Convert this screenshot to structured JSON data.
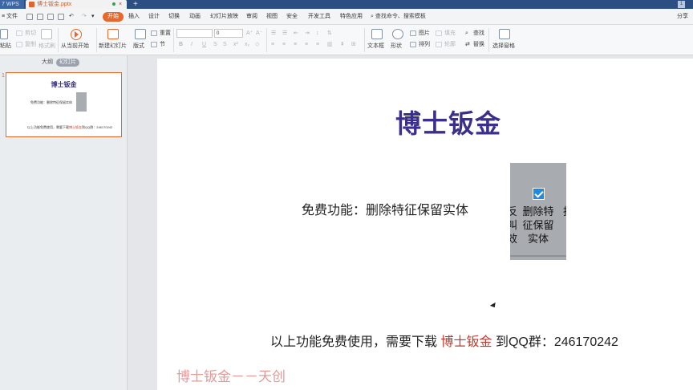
{
  "titlebar": {
    "app_tab": "7 WPS",
    "doc_tab": "博士钣金.pptx",
    "close_glyph": "×",
    "new_tab_glyph": "+",
    "window_badge": "1"
  },
  "menubar": {
    "file_label": "文件",
    "tabs": [
      "开始",
      "插入",
      "设计",
      "切换",
      "动画",
      "幻灯片放映",
      "审阅",
      "视图",
      "安全",
      "开发工具",
      "特色应用"
    ],
    "active_tab": "开始",
    "search_label": "查找命令、搜索模板",
    "share_label": "分享"
  },
  "ribbon": {
    "paste": "粘贴",
    "cut": "剪切",
    "copy": "复制",
    "format_painter": "格式刷",
    "from_current": "从当前开始",
    "new_slide": "新建幻灯片",
    "layout": "版式",
    "section": "节",
    "reset": "重置",
    "font_size": "0",
    "bold": "B",
    "italic": "I",
    "underline": "U",
    "text_box": "文本框",
    "shape": "形状",
    "picture": "图片",
    "arrange": "排列",
    "fill": "填充",
    "outline": "轮廓",
    "find": "查找",
    "replace": "替换",
    "selection_pane": "选择窗格"
  },
  "leftpanel": {
    "tab_outline": "大纲",
    "tab_slides": "幻灯片",
    "thumb_number": "1",
    "thumb_title": "博士钣金",
    "thumb_free": "免费功能：删除特征保留实体",
    "thumb_foot_a": "以上功能免费使用，需要下载",
    "thumb_foot_red": "博士钣金",
    "thumb_foot_b": "到QQ群：246170242"
  },
  "slide": {
    "title": "博士钣金",
    "free_text": "免费功能：删除特征保留实体",
    "image_text": "删除特征保留实体",
    "image_edge_left": "反叫效",
    "image_edge_right": "抄",
    "footer_a": "以上功能免费使用，需要下载",
    "footer_red": "博士钣金",
    "footer_b": "到QQ群：246170242",
    "watermark": "博士钣金－－天创"
  }
}
